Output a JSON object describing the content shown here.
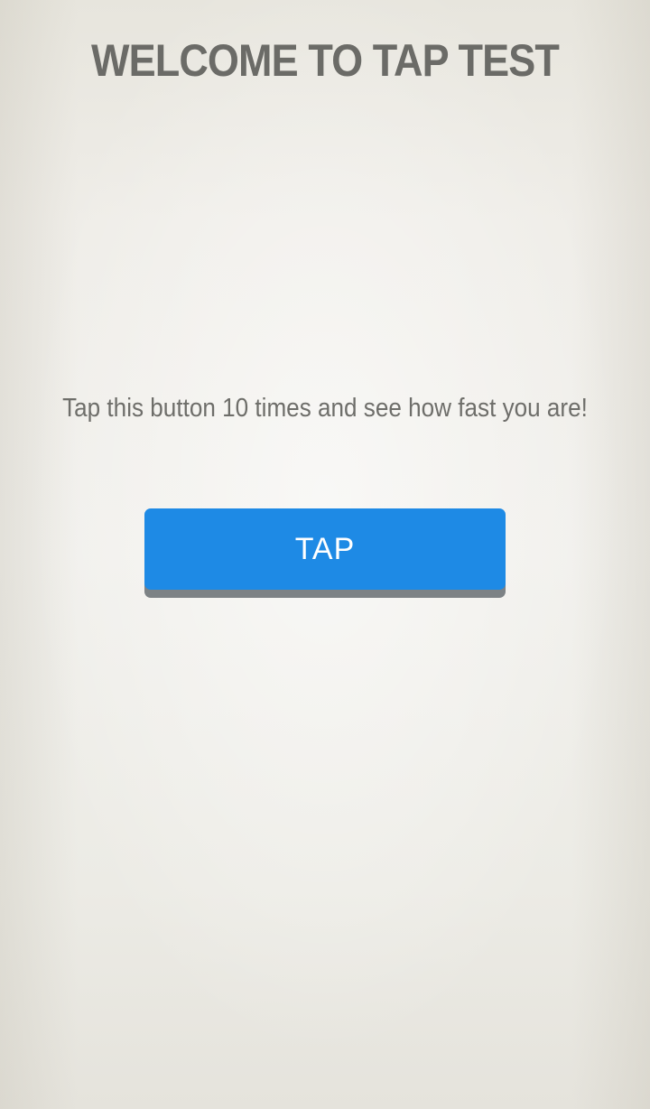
{
  "header": {
    "title": "WELCOME TO TAP TEST"
  },
  "main": {
    "instructions": "Tap this button 10 times and see how fast you are!",
    "tap_button_label": "TAP"
  },
  "colors": {
    "button_background": "#1e8ae5",
    "button_shadow": "#7d8285",
    "text": "#6b6b67",
    "background": "#efede8"
  }
}
